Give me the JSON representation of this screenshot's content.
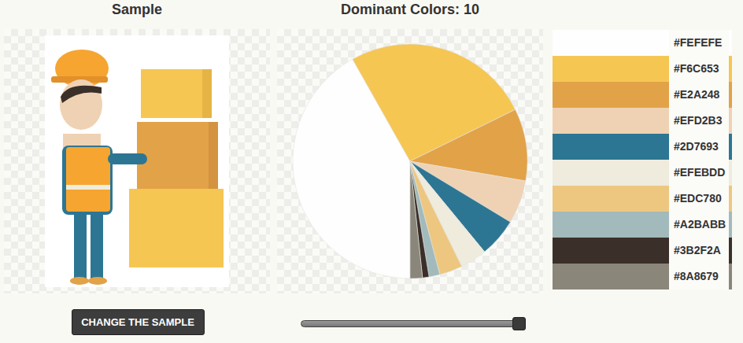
{
  "headings": {
    "sample": "Sample",
    "dominant": "Dominant Colors: 10"
  },
  "button": {
    "label": "CHANGE THE SAMPLE"
  },
  "slider": {
    "level": 1
  },
  "colors": [
    {
      "label": "#FEFEFE",
      "color": "#FEFEFE",
      "share": 42
    },
    {
      "label": "#F6C653",
      "color": "#F6C653",
      "share": 26
    },
    {
      "label": "#E2A248",
      "color": "#E2A248",
      "share": 10
    },
    {
      "label": "#EFD2B3",
      "color": "#EFD2B3",
      "share": 6
    },
    {
      "label": "#2D7693",
      "color": "#2D7693",
      "share": 5.4
    },
    {
      "label": "#EFEBDD",
      "color": "#EFEBDD",
      "share": 3.7
    },
    {
      "label": "#EDC780",
      "color": "#EDC780",
      "share": 3.2
    },
    {
      "label": "#A2BABB",
      "color": "#A2BABB",
      "share": 1.5
    },
    {
      "label": "#3B2F2A",
      "color": "#3B2F2A",
      "share": 0.9
    },
    {
      "label": "#8A8679",
      "color": "#8A8679",
      "share": 1.7
    }
  ]
}
